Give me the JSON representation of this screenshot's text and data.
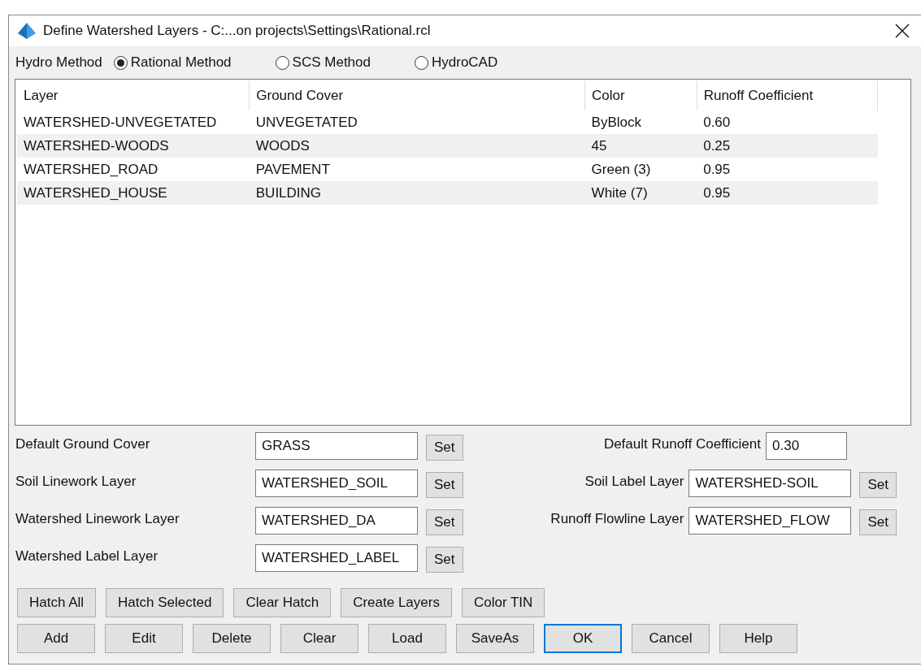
{
  "window": {
    "title": "Define Watershed Layers - C:...on projects\\Settings\\Rational.rcl"
  },
  "hydro_method": {
    "label": "Hydro Method",
    "options": [
      {
        "label": "Rational Method",
        "selected": true
      },
      {
        "label": "SCS Method",
        "selected": false
      },
      {
        "label": "HydroCAD",
        "selected": false
      }
    ]
  },
  "table": {
    "columns": [
      "Layer",
      "Ground Cover",
      "Color",
      "Runoff Coefficient"
    ],
    "rows": [
      [
        "WATERSHED-UNVEGETATED",
        "UNVEGETATED",
        "ByBlock",
        "0.60"
      ],
      [
        "WATERSHED-WOODS",
        "WOODS",
        "45",
        "0.25"
      ],
      [
        "WATERSHED_ROAD",
        "PAVEMENT",
        "Green (3)",
        "0.95"
      ],
      [
        "WATERSHED_HOUSE",
        "BUILDING",
        "White (7)",
        "0.95"
      ]
    ]
  },
  "form_rows": [
    {
      "left": {
        "label": "Default Ground Cover",
        "value": "GRASS",
        "button": "Set"
      },
      "right": {
        "label": "Default Runoff Coefficient",
        "value": "0.30"
      }
    },
    {
      "left": {
        "label": "Soil Linework Layer",
        "value": "WATERSHED_SOIL",
        "button": "Set"
      },
      "right": {
        "label": "Soil Label Layer",
        "value": "WATERSHED-SOIL",
        "button": "Set"
      }
    },
    {
      "left": {
        "label": "Watershed Linework Layer",
        "value": "WATERSHED_DA",
        "button": "Set"
      },
      "right": {
        "label": "Runoff Flowline Layer",
        "value": "WATERSHED_FLOW",
        "button": "Set"
      }
    },
    {
      "left": {
        "label": "Watershed Label Layer",
        "value": "WATERSHED_LABEL",
        "button": "Set"
      }
    }
  ],
  "hatch_buttons": [
    "Hatch All",
    "Hatch Selected",
    "Clear Hatch",
    "Create Layers",
    "Color TIN"
  ],
  "buttons": [
    {
      "label": "Add",
      "default": false
    },
    {
      "label": "Edit",
      "default": false
    },
    {
      "label": "Delete",
      "default": false
    },
    {
      "label": "Clear",
      "default": false
    },
    {
      "label": "Load",
      "default": false
    },
    {
      "label": "SaveAs",
      "default": false
    },
    {
      "label": "OK",
      "default": true
    },
    {
      "label": "Cancel",
      "default": false
    },
    {
      "label": "Help",
      "default": false
    }
  ]
}
